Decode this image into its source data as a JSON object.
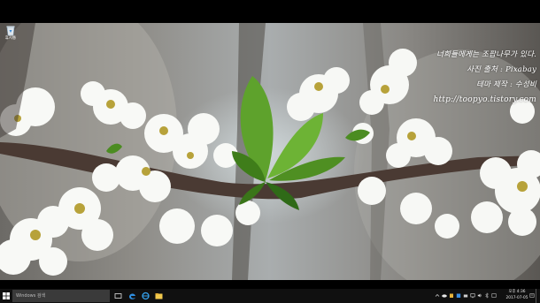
{
  "desktop": {
    "icons": [
      {
        "label": "휴지통",
        "icon": "recycle-bin-icon"
      }
    ]
  },
  "wallpaper": {
    "credits": [
      "너희들에게는 조팝나무가 있다.",
      "사진 출처 : Pixabay",
      "테마 제작 : 수성비",
      "http://toopyo.tistory.com"
    ]
  },
  "taskbar": {
    "search_placeholder": "Windows 검색",
    "apps": [
      "task-view-icon",
      "edge-icon",
      "internet-explorer-icon",
      "file-explorer-icon"
    ],
    "tray_icons": [
      "chevron-up-icon",
      "onedrive-icon",
      "network-icon",
      "volume-icon",
      "ime-icon",
      "notification-icon"
    ],
    "clock": {
      "time": "오후 4:36",
      "date": "2017-07-05"
    }
  }
}
